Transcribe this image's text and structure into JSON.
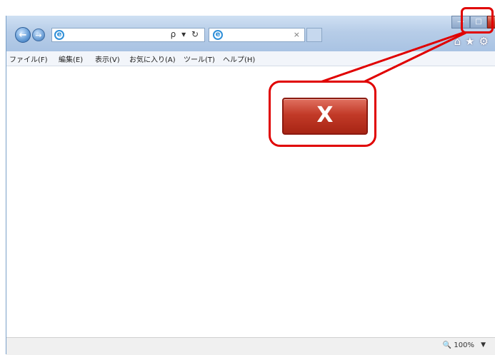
{
  "addressbar": {
    "tools": "ρ ▾ ↻"
  },
  "tab": {
    "close": "×"
  },
  "window_controls": {
    "minimize": "—",
    "maximize": "□",
    "close": "X"
  },
  "toolbar": {
    "icons": [
      "home-icon",
      "favorites-star-icon",
      "settings-gear-icon"
    ]
  },
  "menu": [
    "ファイル(F)",
    "編集(E)",
    "表示(V)",
    "お気に入り(A)",
    "ツール(T)",
    "ヘルプ(H)"
  ],
  "status": {
    "zoom": "🔍 100%",
    "zoom_dropdown": "▼"
  },
  "callout": {
    "close_label": "X",
    "highlight_color": "#e00000"
  }
}
